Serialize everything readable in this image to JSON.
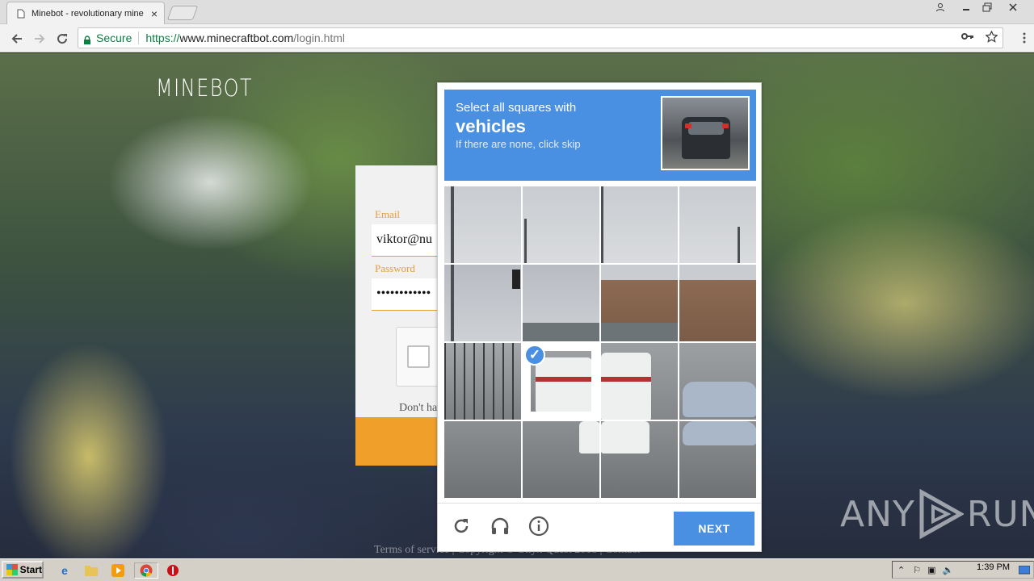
{
  "browser": {
    "tab_title": "Minebot - revolutionary mine",
    "tab_close": "×",
    "url_secure": "Secure",
    "url_scheme": "https://",
    "url_host": "www.minecraftbot.com",
    "url_path": "/login.html"
  },
  "page": {
    "logo": "MINEBOT",
    "email_label": "Email",
    "email_value": "viktor@nu",
    "password_label": "Password",
    "password_value": "••••••••••••",
    "signup_text": "Don't ha",
    "footer_text": "Terms of service | Copyright © Onyx Quest 2018 | Contact"
  },
  "captcha": {
    "line1": "Select all squares with",
    "line2": "vehicles",
    "line3": "If there are none, click skip",
    "next_label": "NEXT",
    "selected_tiles": [
      9
    ],
    "tile_count": 16
  },
  "watermark": {
    "left": "ANY",
    "right": "RUN"
  },
  "taskbar": {
    "start_label": "Start",
    "clock": "1:39 PM"
  },
  "colors": {
    "captcha_blue": "#4a90e2",
    "accent_orange": "#f0a02a",
    "secure_green": "#0b8043"
  }
}
